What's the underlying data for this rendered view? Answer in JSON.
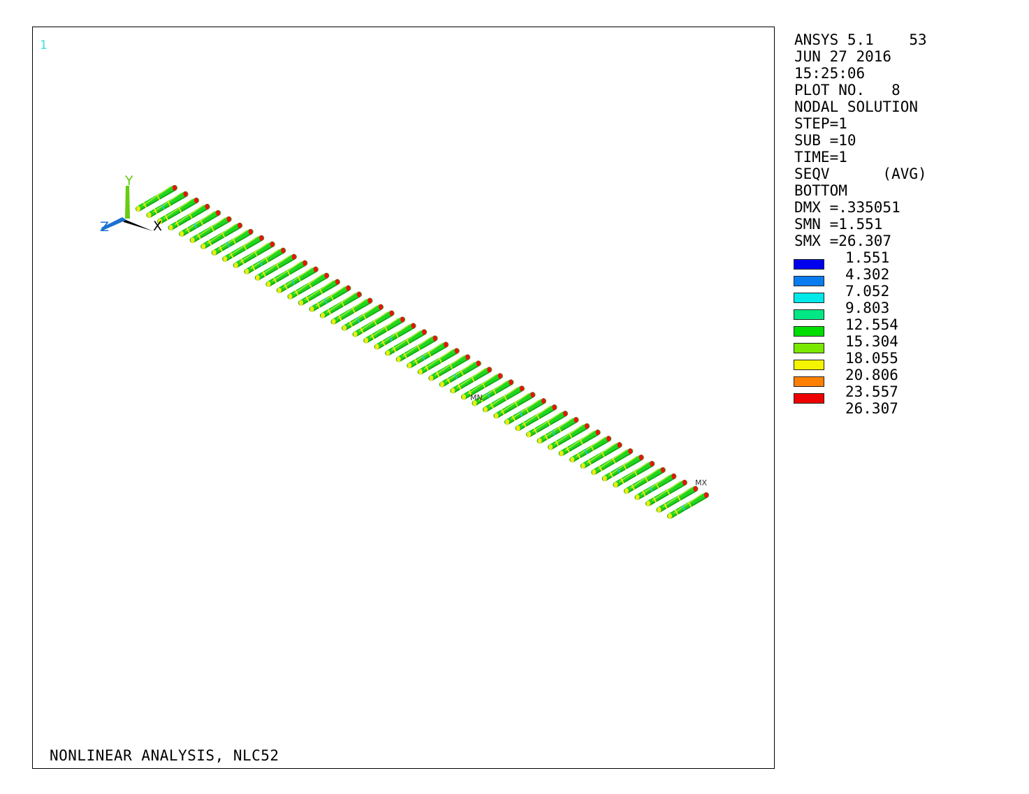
{
  "viewport": {
    "window_number": "1",
    "title": "NONLINEAR ANALYSIS, NLC52",
    "triad": {
      "x_label": "X",
      "y_label": "Y",
      "z_label": "Z"
    },
    "markers": {
      "min": "MN",
      "max": "MX"
    },
    "model": {
      "element_count": 50
    }
  },
  "info": {
    "lines": [
      "ANSYS 5.1    53",
      "JUN 27 2016",
      "15:25:06",
      "PLOT NO.   8",
      "NODAL SOLUTION",
      "STEP=1",
      "SUB =10",
      "TIME=1",
      "SEQV      (AVG)",
      "BOTTOM",
      "DMX =.335051",
      "SMN =1.551",
      "SMX =26.307"
    ]
  },
  "legend": {
    "values": [
      "1.551",
      "4.302",
      "7.052",
      "9.803",
      "12.554",
      "15.304",
      "18.055",
      "20.806",
      "23.557",
      "26.307"
    ],
    "colors": [
      "#0000ee",
      "#0a7cf0",
      "#00e8e8",
      "#00e883",
      "#00dd00",
      "#7ae800",
      "#f4f400",
      "#ff8000",
      "#ee0000"
    ]
  },
  "colors": {
    "tube_main": "#1fd61f",
    "tube_dark": "#13a813",
    "tube_highlight": "#a5ee32",
    "tube_yellow": "#ecec10",
    "tube_cyan": "#27c5e6",
    "tube_end": "#ee1010",
    "triad_x": "#000000",
    "triad_y": "#66cc11",
    "triad_z": "#1a70d0",
    "window_number": "#33e0e0"
  }
}
